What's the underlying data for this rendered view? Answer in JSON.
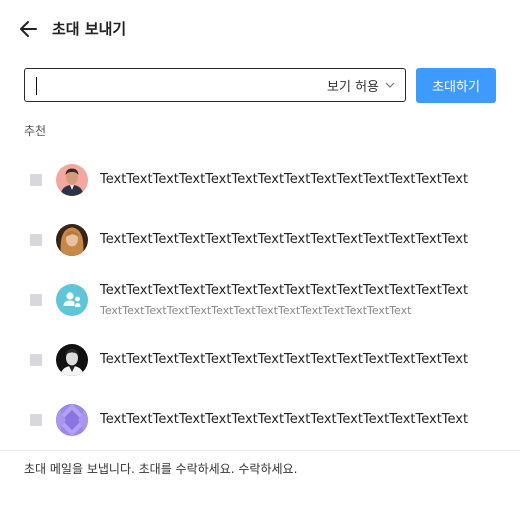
{
  "header": {
    "title": "초대 보내기"
  },
  "search": {
    "value": "",
    "permission_label": "보기 허용"
  },
  "invite_button": {
    "label": "초대하기"
  },
  "recommend_label": "추천",
  "recipients": [
    {
      "name": "TextTextTextTextTextTextTextTextTextTextTextTextTextText",
      "sub": "",
      "avatar": "photo-man-red"
    },
    {
      "name": "TextTextTextTextTextTextTextTextTextTextTextTextTextText",
      "sub": "",
      "avatar": "photo-woman-blonde"
    },
    {
      "name": "TextTextTextTextTextTextTextTextTextTextTextTextTextText",
      "sub": "TextTextTextTextTextTextTextTextTextTextTextTextTextText",
      "avatar": "group-icon"
    },
    {
      "name": "TextTextTextTextTextTextTextTextTextTextTextTextTextText",
      "sub": "",
      "avatar": "photo-man-bw"
    },
    {
      "name": "TextTextTextTextTextTextTextTextTextTextTextTextTextText",
      "sub": "",
      "avatar": "diamond-pattern-icon"
    }
  ],
  "footer": {
    "text": "초대 메일을 보냅니다. 초대를 수락하세요. 수락하세요."
  },
  "colors": {
    "accent": "#3d9bff",
    "group_avatar": "#5fc6d9",
    "checkbox": "#d8d8dc"
  }
}
